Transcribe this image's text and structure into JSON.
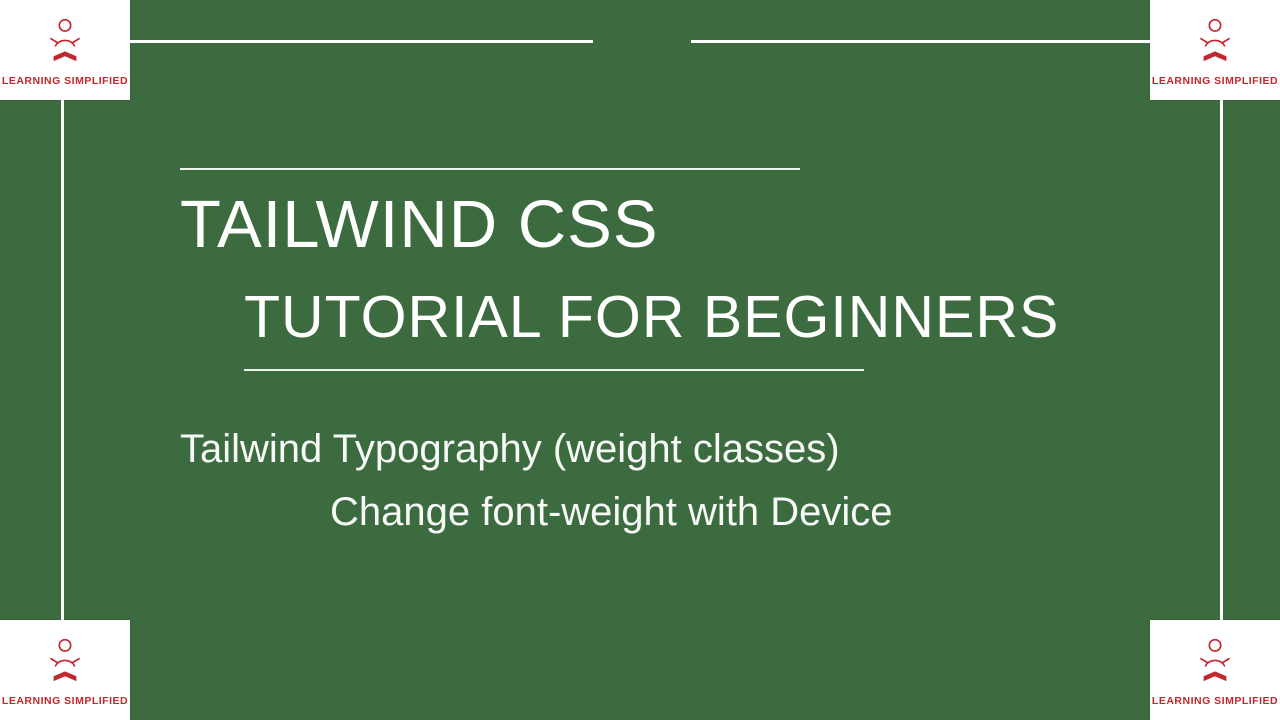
{
  "logo": {
    "caption": "LEARNING SIMPLIFIED"
  },
  "slide": {
    "title_line1": "TAILWIND CSS",
    "title_line2": "TUTORIAL FOR BEGINNERS",
    "subtitle_line1": "Tailwind Typography (weight classes)",
    "subtitle_line2": "Change font-weight with Device"
  },
  "colors": {
    "background": "#3c6b3f",
    "text": "#ffffff",
    "logo_text": "#c1272d"
  }
}
